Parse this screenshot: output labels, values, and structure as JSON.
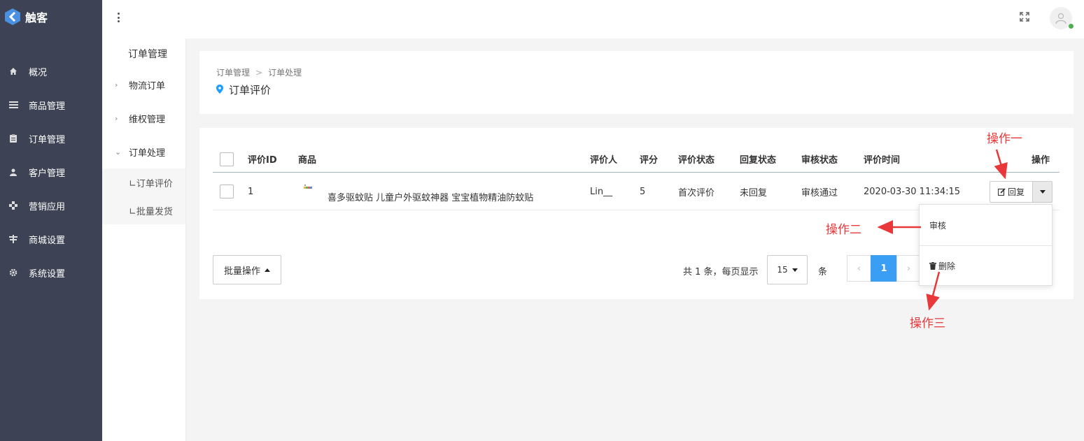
{
  "brand": {
    "name": "触客"
  },
  "sidebar": {
    "items": [
      {
        "label": "概况",
        "icon": "home-icon"
      },
      {
        "label": "商品管理",
        "icon": "list-icon"
      },
      {
        "label": "订单管理",
        "icon": "clipboard-icon"
      },
      {
        "label": "客户管理",
        "icon": "user-icon"
      },
      {
        "label": "营销应用",
        "icon": "puzzle-icon"
      },
      {
        "label": "商城设置",
        "icon": "store-icon"
      },
      {
        "label": "系统设置",
        "icon": "gear-icon"
      }
    ]
  },
  "subnav": {
    "title": "订单管理",
    "groups": [
      {
        "label": "物流订单",
        "chevron": "›"
      },
      {
        "label": "维权管理",
        "chevron": "›"
      },
      {
        "label": "订单处理",
        "chevron": "⌄"
      }
    ],
    "subitems": [
      "∟订单评价",
      "∟批量发货"
    ]
  },
  "breadcrumb": {
    "root": "订单管理",
    "sep": ">",
    "current": "订单处理"
  },
  "page": {
    "title": "订单评价"
  },
  "table": {
    "headers": {
      "id": "评价ID",
      "product": "商品",
      "reviewer": "评价人",
      "score": "评分",
      "review_status": "评价状态",
      "reply_status": "回复状态",
      "audit_status": "审核状态",
      "review_time": "评价时间",
      "action": "操作"
    },
    "rows": [
      {
        "id": "1",
        "product": "喜多驱蚊贴 儿童户外驱蚊神器 宝宝植物精油防蚊贴",
        "reviewer": "Lin__",
        "score": "5",
        "review_status": "首次评价",
        "reply_status": "未回复",
        "audit_status": "审核通过",
        "review_time": "2020-03-30 11:34:15",
        "action_label": "回复"
      }
    ]
  },
  "footer": {
    "batch_label": "批量操作",
    "summary": "共 1 条，每页显示",
    "page_size": "15",
    "unit": "条",
    "current_page": "1",
    "prev": "‹",
    "next": "›"
  },
  "dropdown": {
    "audit": "审核",
    "delete": "删除"
  },
  "annotations": {
    "op1": "操作一",
    "op2": "操作二",
    "op3": "操作三"
  },
  "colors": {
    "sidebar_bg": "#3d4354",
    "accent": "#3a9ef5",
    "annotation": "#e8383a",
    "online": "#4caf50"
  }
}
